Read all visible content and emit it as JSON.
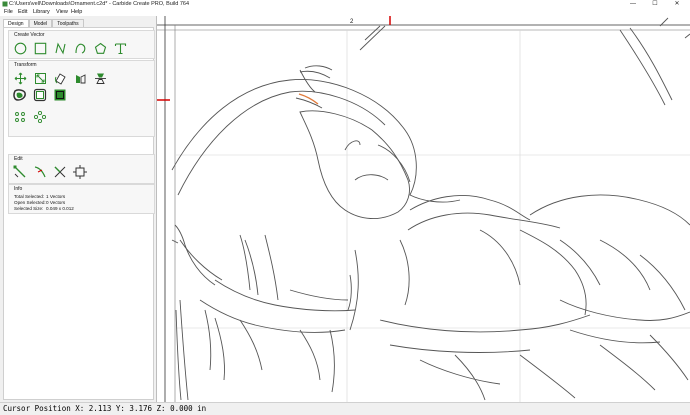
{
  "window": {
    "title": "C:\\Users\\vell\\Downloads\\Ornament.c2d* - Carbide Create PRO, Build 764",
    "minimize": "—",
    "maximize": "☐",
    "close": "✕"
  },
  "menu": [
    "File",
    "Edit",
    "Library",
    "View",
    "Help"
  ],
  "tabs": [
    "Design",
    "Model",
    "Toolpaths"
  ],
  "groups": {
    "create_vector": "Create Vector",
    "transform": "Transform",
    "edit": "Edit",
    "info": "Info"
  },
  "info": {
    "total_selected_label": "Total Selected:",
    "total_selected_value": "1 Vectors",
    "open_selected_label": "Open Selected:",
    "open_selected_value": "0 Vectors",
    "selected_size_label": "Selected Size:",
    "selected_size_value": "0.049 x 0.012"
  },
  "ruler": {
    "top_label": "2"
  },
  "status": {
    "cursor": "Cursor Position X: 2.113 Y: 3.176 Z: 0.000 in"
  },
  "colors": {
    "accent_green": "#2e8b2e",
    "ruler_marker": "#d40000"
  }
}
